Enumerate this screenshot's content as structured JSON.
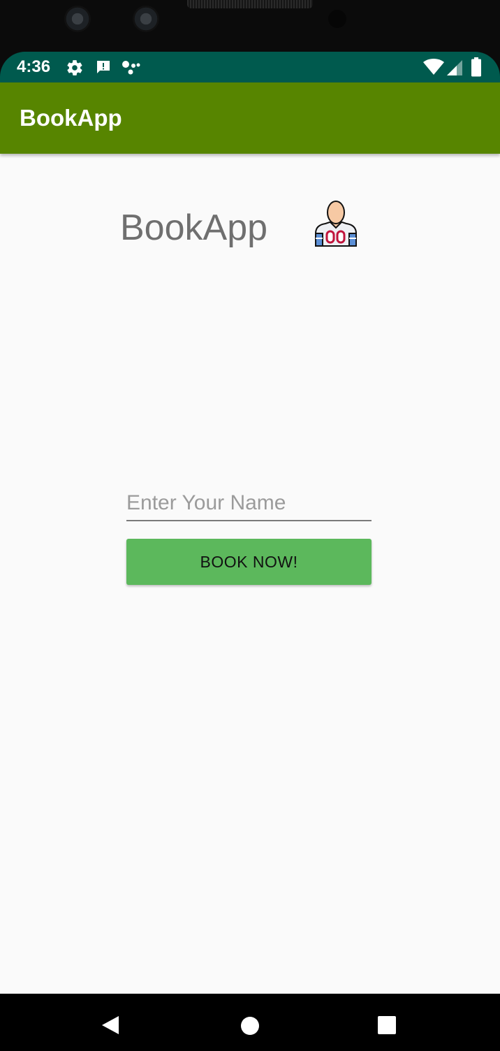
{
  "status_bar": {
    "time": "4:36",
    "icons": [
      "gear-icon",
      "alert-message-icon",
      "assistant-dots-icon",
      "wifi-icon",
      "cell-signal-icon",
      "battery-icon"
    ],
    "background_color": "#005a4e"
  },
  "app_bar": {
    "title": "BookApp",
    "background_color": "#578500"
  },
  "main": {
    "heading": "BookApp",
    "mascot_icon": "player-mascot-icon",
    "name_input": {
      "placeholder": "Enter Your Name",
      "value": ""
    },
    "book_button": {
      "label": "BOOK NOW!",
      "color": "#5cb85c"
    }
  },
  "nav_bar": {
    "buttons": [
      "back-icon",
      "home-icon",
      "recents-icon"
    ]
  }
}
